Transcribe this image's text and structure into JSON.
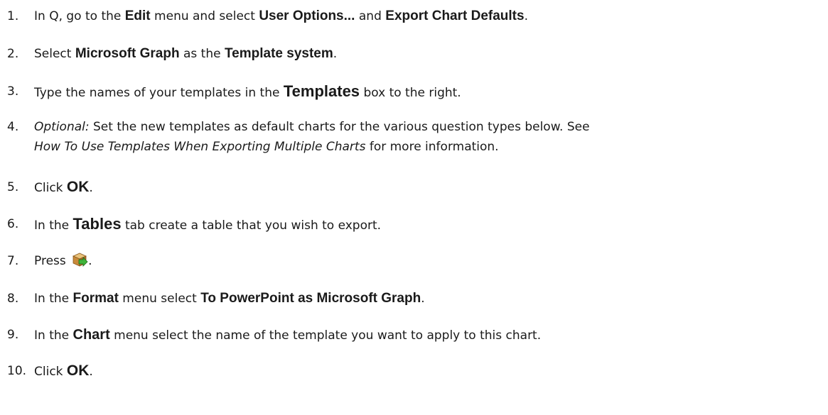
{
  "steps": [
    {
      "number": "1.",
      "parts": [
        "In Q, go to the ",
        "Edit",
        " menu and select ",
        "User Options...",
        " and ",
        "Export Chart Defaults",
        "."
      ]
    },
    {
      "number": "2.",
      "parts": [
        "Select ",
        "Microsoft Graph",
        " as the ",
        "Template system",
        "."
      ]
    },
    {
      "number": "3.",
      "parts": [
        "Type the names of your templates in the ",
        "Templates",
        " box to the right."
      ]
    },
    {
      "number": "4.",
      "parts": [
        "Optional:",
        " Set the new templates as default charts for the various question types below.  See",
        "How To Use Templates When Exporting Multiple Charts",
        " for more information."
      ]
    },
    {
      "number": "5.",
      "parts": [
        "Click ",
        "OK",
        "."
      ]
    },
    {
      "number": "6.",
      "parts": [
        "In the ",
        "Tables",
        " tab create a table that you wish to export."
      ]
    },
    {
      "number": "7.",
      "parts": [
        "Press ",
        "."
      ],
      "icon": "export-package-icon"
    },
    {
      "number": "8.",
      "parts": [
        "In the ",
        "Format",
        " menu select ",
        "To PowerPoint as Microsoft Graph",
        "."
      ]
    },
    {
      "number": "9.",
      "parts": [
        "In the ",
        "Chart",
        " menu select the name of the template you want to apply to this chart."
      ]
    },
    {
      "number": "10.",
      "parts": [
        "Click ",
        "OK",
        "."
      ]
    }
  ]
}
